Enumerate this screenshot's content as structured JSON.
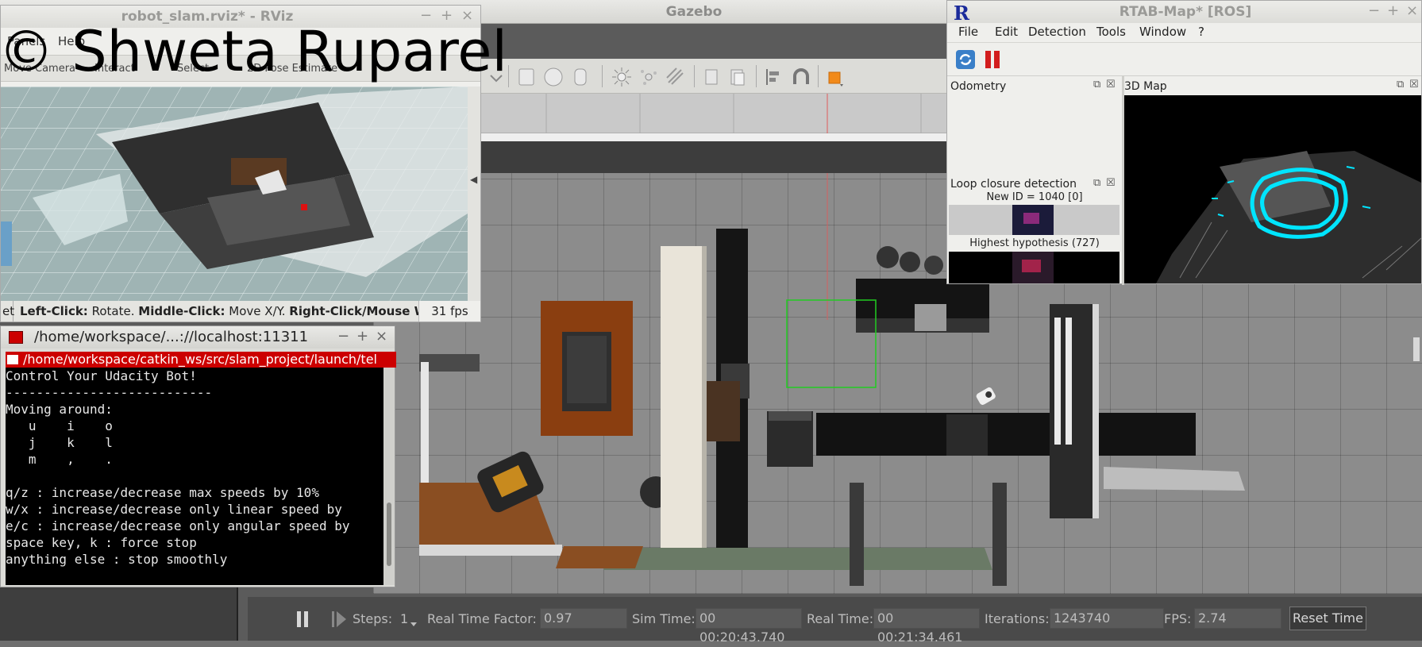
{
  "gazebo": {
    "title": "Gazebo",
    "bottom": {
      "steps_label": "Steps:",
      "steps_value": "1",
      "rtf_label": "Real Time Factor:",
      "rtf_value": "0.97",
      "sim_label": "Sim Time:",
      "sim_value": "00 00:20:43.740",
      "real_label": "Real Time:",
      "real_value": "00 00:21:34.461",
      "iter_label": "Iterations:",
      "iter_value": "1243740",
      "fps_label": "FPS:",
      "fps_value": "2.74",
      "reset_label": "Reset Time"
    }
  },
  "rviz": {
    "title": "robot_slam.rviz* - RViz",
    "menu": [
      "Panels",
      "Help"
    ],
    "tools": [
      "Move Camera",
      "Interact",
      "Select",
      "2D Pose Estimate"
    ],
    "tools_more": "»",
    "status": {
      "tab": "et",
      "lc_bold": "Left-Click:",
      "lc": "Rotate.",
      "mc_bold": "Middle-Click:",
      "mc": "Move X/Y.",
      "rc_bold": "Right-Click/Mouse Whe",
      "fps": "31 fps"
    }
  },
  "terminal": {
    "title": "/home/workspace/...://localhost:11311",
    "tab": "/home/workspace/catkin_ws/src/slam_project/launch/tel",
    "lines": [
      "Control Your Udacity Bot!",
      "---------------------------",
      "Moving around:",
      "   u    i    o",
      "   j    k    l",
      "   m    ,    .",
      "",
      "q/z : increase/decrease max speeds by 10%",
      "w/x : increase/decrease only linear speed by",
      "e/c : increase/decrease only angular speed by",
      "space key, k : force stop",
      "anything else : stop smoothly"
    ]
  },
  "rtabmap": {
    "logo": "R",
    "title": "RTAB-Map* [ROS]",
    "menu": [
      "File",
      "Edit",
      "Detection",
      "Tools",
      "Window",
      "?"
    ],
    "odometry": "Odometry",
    "map3d": "3D Map",
    "loop": "Loop closure detection",
    "new_id": "New ID = 1040 [0]",
    "highest": "Highest hypothesis (727)"
  },
  "watermark": "© Shweta Ruparel",
  "colors": {
    "terminal_tab": "#cc0000",
    "rtab_path": "#00e5ff",
    "gazebo_select": "#22cc22"
  }
}
